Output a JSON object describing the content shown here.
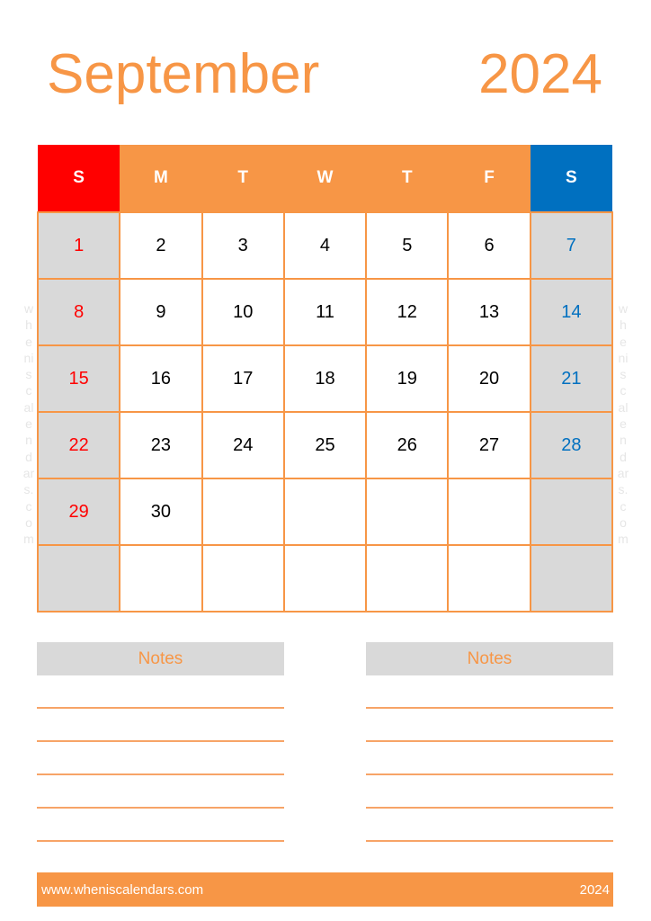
{
  "header": {
    "month": "September",
    "year": "2024"
  },
  "calendar": {
    "weekdays": [
      "S",
      "M",
      "T",
      "W",
      "T",
      "F",
      "S"
    ],
    "weeks": [
      [
        "1",
        "2",
        "3",
        "4",
        "5",
        "6",
        "7"
      ],
      [
        "8",
        "9",
        "10",
        "11",
        "12",
        "13",
        "14"
      ],
      [
        "15",
        "16",
        "17",
        "18",
        "19",
        "20",
        "21"
      ],
      [
        "22",
        "23",
        "24",
        "25",
        "26",
        "27",
        "28"
      ],
      [
        "29",
        "30",
        "",
        "",
        "",
        "",
        ""
      ],
      [
        "",
        "",
        "",
        "",
        "",
        "",
        ""
      ]
    ],
    "colors": {
      "sunday": "#ff0000",
      "saturday": "#0070c0",
      "accent": "#f79646",
      "weekend_bg": "#d9d9d9"
    }
  },
  "watermark": {
    "text_chars": [
      "w",
      "h",
      "e",
      "ni",
      "s",
      "c",
      "al",
      "e",
      "n",
      "d",
      "ar",
      "s.",
      "c",
      "o",
      "m"
    ]
  },
  "notes": [
    {
      "title": "Notes",
      "lines": 5
    },
    {
      "title": "Notes",
      "lines": 5
    }
  ],
  "footer": {
    "url": "www.wheniscalendars.com",
    "year": "2024"
  }
}
